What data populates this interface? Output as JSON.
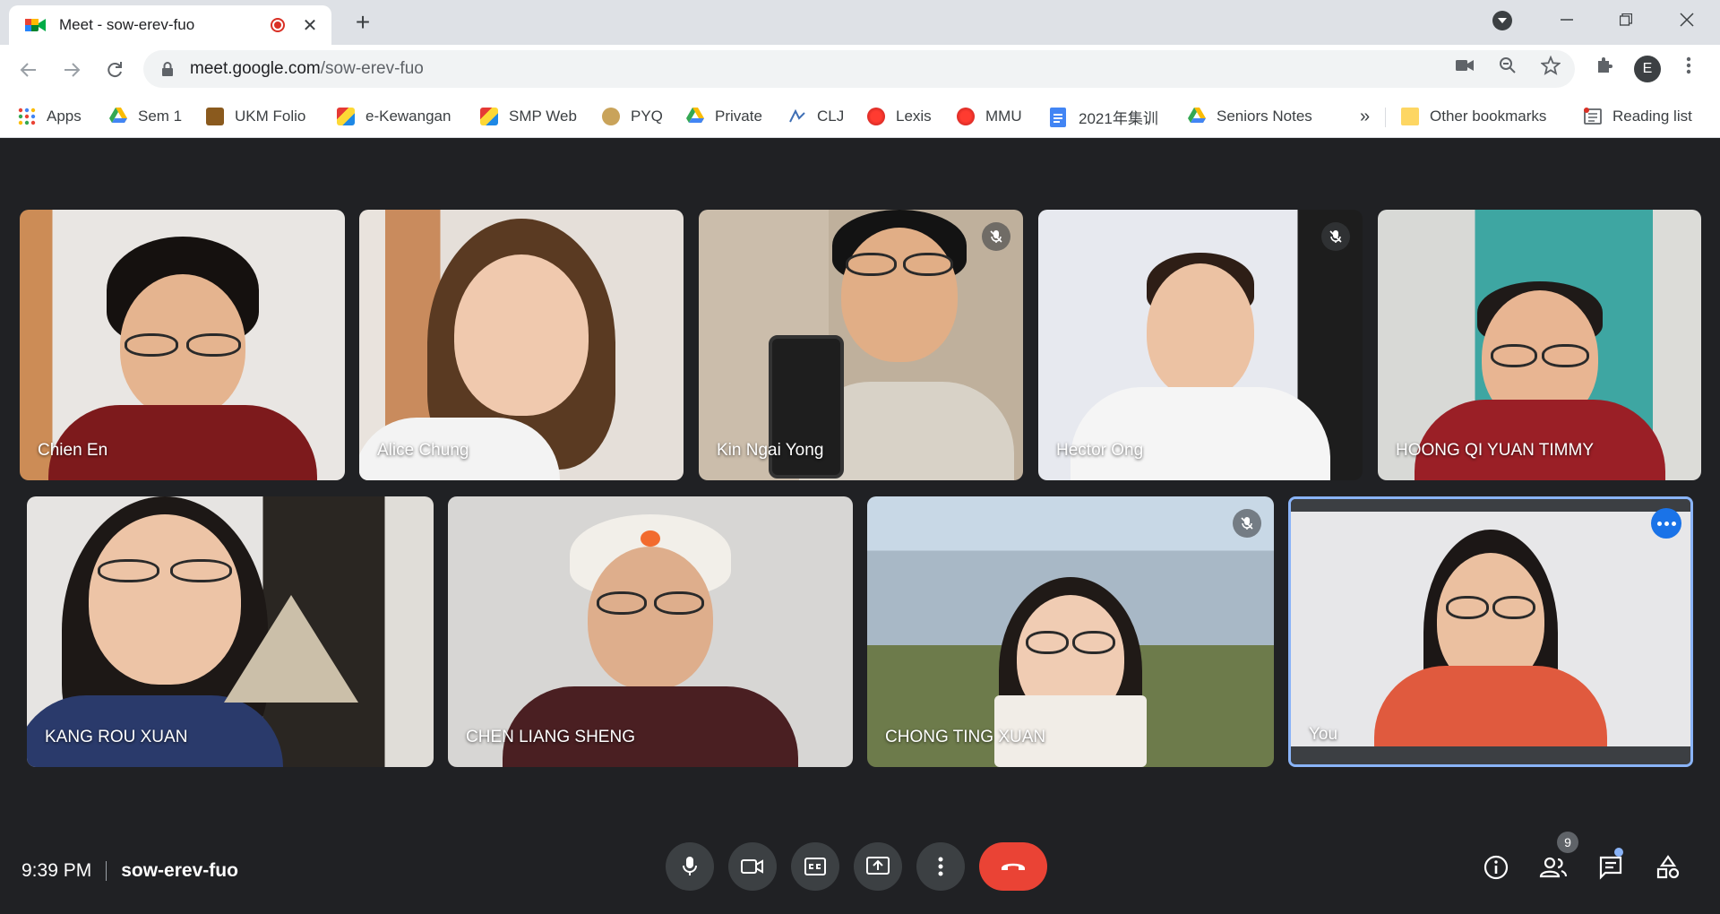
{
  "browser": {
    "tab_title": "Meet - sow-erev-fuo",
    "url_host": "meet.google.com",
    "url_path": "/sow-erev-fuo",
    "profile_initial": "E"
  },
  "bookmarks": {
    "items": [
      {
        "label": "Apps",
        "icon": "apps-grid-icon"
      },
      {
        "label": "Sem 1",
        "icon": "google-drive-icon"
      },
      {
        "label": "UKM Folio",
        "icon": "moodle-icon"
      },
      {
        "label": "e-Kewangan",
        "icon": "ukm-icon"
      },
      {
        "label": "SMP Web",
        "icon": "ukm-icon"
      },
      {
        "label": "PYQ",
        "icon": "pyq-icon"
      },
      {
        "label": "Private",
        "icon": "google-drive-icon"
      },
      {
        "label": "CLJ",
        "icon": "clj-icon"
      },
      {
        "label": "Lexis",
        "icon": "lexis-icon"
      },
      {
        "label": "MMU",
        "icon": "lexis-icon"
      },
      {
        "label": "2021年集训",
        "icon": "google-docs-icon"
      },
      {
        "label": "Seniors Notes",
        "icon": "google-drive-icon"
      }
    ],
    "overflow": "»",
    "other": "Other bookmarks",
    "reading_list": "Reading list"
  },
  "participants": [
    {
      "name": "Chien En",
      "muted": false
    },
    {
      "name": "Alice Chung",
      "muted": false
    },
    {
      "name": "Kin Ngai Yong",
      "muted": true
    },
    {
      "name": "Hector Ong",
      "muted": true
    },
    {
      "name": "HOONG QI YUAN TIMMY",
      "muted": false
    },
    {
      "name": "KANG ROU XUAN",
      "muted": false
    },
    {
      "name": "CHEN LIANG SHENG",
      "muted": false
    },
    {
      "name": "CHONG TING XUAN",
      "muted": true
    },
    {
      "name": "You",
      "muted": false
    }
  ],
  "meeting": {
    "time": "9:39 PM",
    "code": "sow-erev-fuo",
    "people_count": "9"
  },
  "colors": {
    "stage": "#202124",
    "control": "#3c4043",
    "end_call": "#ea4335",
    "self_border": "#8ab4f8"
  }
}
